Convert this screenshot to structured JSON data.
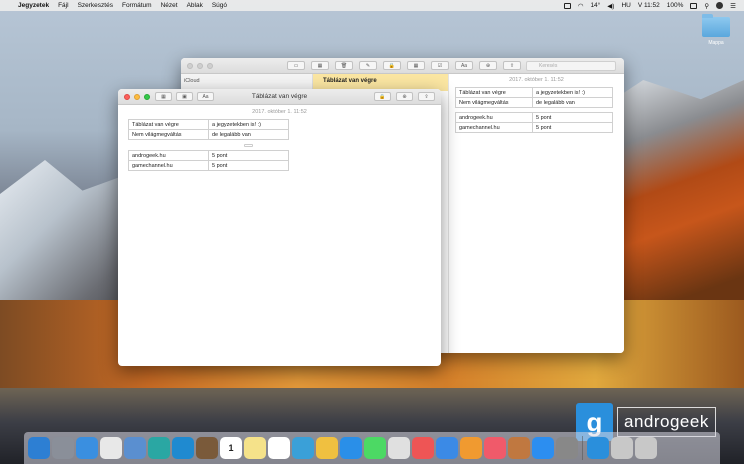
{
  "menubar": {
    "apple": "",
    "app_name": "Jegyzetek",
    "items": [
      "Fájl",
      "Szerkesztés",
      "Formátum",
      "Nézet",
      "Ablak",
      "Súgó"
    ],
    "temperature": "14°",
    "input_source": "HU",
    "clock": "V 11:52",
    "battery": "100%"
  },
  "desktop": {
    "folder_label": "Mappa"
  },
  "back_window": {
    "search_placeholder": "Keresés",
    "sidebar_account": "iCloud",
    "selected_note_title": "Táblázat van végre",
    "note_date": "2017. október 1. 11:52",
    "table1": [
      [
        "Táblázat van végre",
        "a jegyzetekben is! :)"
      ],
      [
        "Nem világmegváltás",
        "de legalább van"
      ]
    ],
    "table2": [
      [
        "androgeek.hu",
        "5 pont"
      ],
      [
        "gamechannel.hu",
        "5 pont"
      ]
    ]
  },
  "front_window": {
    "title": "Táblázat van végre",
    "format_button": "Aa",
    "note_date": "2017. október 1. 11:52",
    "table1": [
      [
        "Táblázat van végre",
        "a jegyzetekben is! :)"
      ],
      [
        "Nem világmegváltás",
        "de legalább van"
      ]
    ],
    "table2": [
      [
        "androgeek.hu",
        "5 pont"
      ],
      [
        "gamechannel.hu",
        "5 pont"
      ]
    ]
  },
  "watermark": {
    "logo": "g",
    "text": "androgeek"
  },
  "dock": {
    "calendar_day": "1",
    "app_colors": [
      "#2d7fd3",
      "#8a8f99",
      "#3a8fe0",
      "#e8e8e8",
      "#5a8fd0",
      "#2aa7a3",
      "#1f8ad0",
      "#7a5a3a",
      "#ffffff",
      "#f5e28a",
      "#ffffff",
      "#3aa0d8",
      "#f0c040",
      "#2a8fe8",
      "#4cd964",
      "#e0e0e0",
      "#ee5555",
      "#3b8ae6",
      "#f09a30",
      "#f05a6a",
      "#c07840",
      "#2c8ef0",
      "#888888",
      "#2a8fdc",
      "#c8c8c8",
      "#c8c8c8",
      "#d8d8d8"
    ]
  }
}
